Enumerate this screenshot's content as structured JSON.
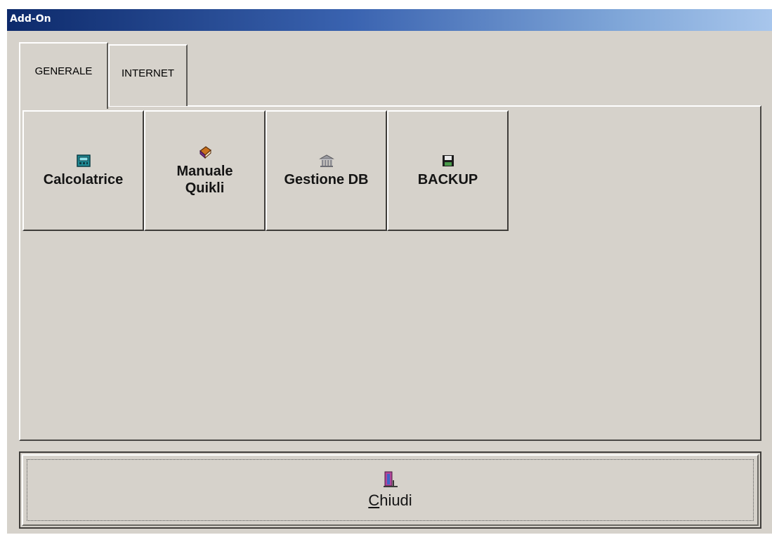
{
  "window": {
    "title": "Add-On"
  },
  "tabs": [
    {
      "label": "GENERALE",
      "active": true
    },
    {
      "label": "INTERNET",
      "active": false
    }
  ],
  "tools": [
    {
      "label": "Calcolatrice",
      "icon": "calculator-icon"
    },
    {
      "label": "Manuale\nQuikli",
      "icon": "book-icon"
    },
    {
      "label": "Gestione DB",
      "icon": "database-building-icon"
    },
    {
      "label": "BACKUP",
      "icon": "floppy-disk-icon"
    }
  ],
  "close_button": {
    "mnemonic": "C",
    "label_rest": "hiudi",
    "icon": "door-exit-icon"
  },
  "colors": {
    "face": "#d6d2cb",
    "title_gradient_start": "#0d2a6b",
    "title_gradient_end": "#a8c6ec"
  }
}
